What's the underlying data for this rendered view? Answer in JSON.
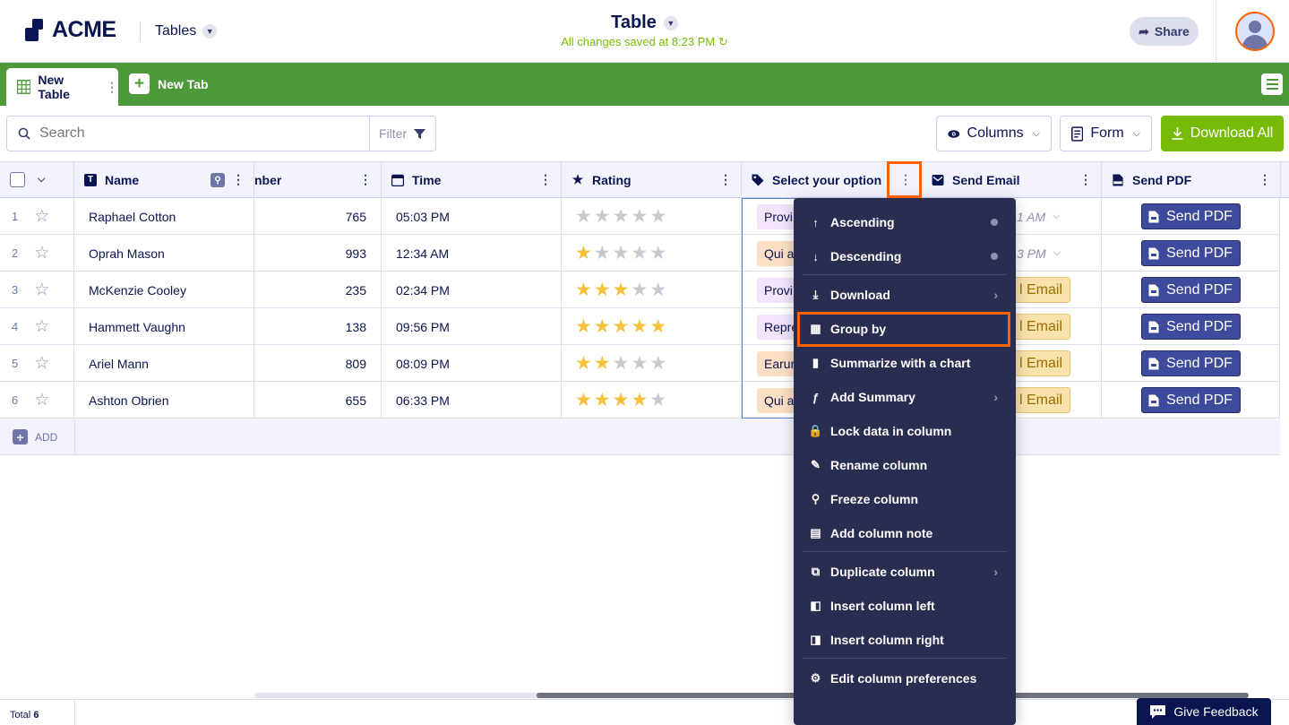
{
  "header": {
    "logo_text": "ACME",
    "section": "Tables",
    "doc_title": "Table",
    "saved_status": "All changes saved at 8:23 PM",
    "share_label": "Share"
  },
  "tabs": {
    "active": "New Table",
    "new_tab": "New Tab"
  },
  "toolbar": {
    "search_placeholder": "Search",
    "filter_label": "Filter",
    "columns_label": "Columns",
    "form_label": "Form",
    "download_all_label": "Download All"
  },
  "columns": [
    {
      "label": "Name",
      "icon": "text-type-icon"
    },
    {
      "label": "nber",
      "icon": ""
    },
    {
      "label": "Time",
      "icon": "calendar-icon"
    },
    {
      "label": "Rating",
      "icon": "star-icon"
    },
    {
      "label": "Select your option",
      "icon": "tag-icon"
    },
    {
      "label": "Send Email",
      "icon": "email-icon"
    },
    {
      "label": "Send PDF",
      "icon": "pdf-icon"
    }
  ],
  "rows": [
    {
      "num": "1",
      "name": "Raphael Cotton",
      "number": "765",
      "time": "05:03 PM",
      "rating": 0,
      "option": "Provi",
      "email": "1 AM",
      "email_type": "time",
      "pdf": "Send PDF"
    },
    {
      "num": "2",
      "name": "Oprah Mason",
      "number": "993",
      "time": "12:34 AM",
      "rating": 1,
      "option": "Qui a",
      "email": "3 PM",
      "email_type": "time",
      "pdf": "Send PDF"
    },
    {
      "num": "3",
      "name": "McKenzie Cooley",
      "number": "235",
      "time": "02:34 PM",
      "rating": 3,
      "option": "Provi",
      "email": "l Email",
      "email_type": "button",
      "pdf": "Send PDF"
    },
    {
      "num": "4",
      "name": "Hammett Vaughn",
      "number": "138",
      "time": "09:56 PM",
      "rating": 5,
      "option": "Repre",
      "email": "l Email",
      "email_type": "button",
      "pdf": "Send PDF"
    },
    {
      "num": "5",
      "name": "Ariel Mann",
      "number": "809",
      "time": "08:09 PM",
      "rating": 2,
      "option": "Earur",
      "email": "l Email",
      "email_type": "button",
      "pdf": "Send PDF"
    },
    {
      "num": "6",
      "name": "Ashton Obrien",
      "number": "655",
      "time": "06:33 PM",
      "rating": 4,
      "option": "Qui a",
      "email": "l Email",
      "email_type": "button",
      "pdf": "Send PDF"
    }
  ],
  "option_colors": {
    "Provi": "#f3e3fb",
    "Qui a": "#fbdfc4",
    "Repre": "#f3e3fb",
    "Earur": "#fbdfc4"
  },
  "add_row_label": "ADD",
  "footer": {
    "total_label": "Total",
    "total_value": "6",
    "feedback_label": "Give Feedback"
  },
  "context_menu": {
    "items": [
      {
        "label": "Ascending",
        "icon": "sort-ascending-icon",
        "trail": "dot"
      },
      {
        "label": "Descending",
        "icon": "sort-descending-icon",
        "trail": "dot"
      },
      {
        "label": "Download",
        "icon": "download-icon",
        "trail": "chevron"
      },
      {
        "label": "Group by",
        "icon": "group-by-icon",
        "trail": ""
      },
      {
        "label": "Summarize with a chart",
        "icon": "bar-chart-icon",
        "trail": ""
      },
      {
        "label": "Add Summary",
        "icon": "function-icon",
        "trail": "chevron"
      },
      {
        "label": "Lock data in column",
        "icon": "lock-icon",
        "trail": ""
      },
      {
        "label": "Rename column",
        "icon": "pencil-icon",
        "trail": ""
      },
      {
        "label": "Freeze column",
        "icon": "pin-icon",
        "trail": ""
      },
      {
        "label": "Add column note",
        "icon": "note-icon",
        "trail": ""
      },
      {
        "label": "Duplicate column",
        "icon": "duplicate-icon",
        "trail": "chevron"
      },
      {
        "label": "Insert column left",
        "icon": "insert-left-icon",
        "trail": ""
      },
      {
        "label": "Insert column right",
        "icon": "insert-right-icon",
        "trail": ""
      },
      {
        "label": "Edit column preferences",
        "icon": "gear-icon",
        "trail": ""
      }
    ]
  },
  "colors": {
    "accent_green": "#78bb07",
    "tab_green": "#4e9a3a",
    "navy": "#0a1551",
    "highlight": "#ff6100",
    "pdf_button": "#3e4b9d",
    "menu_bg": "#292d4f"
  }
}
